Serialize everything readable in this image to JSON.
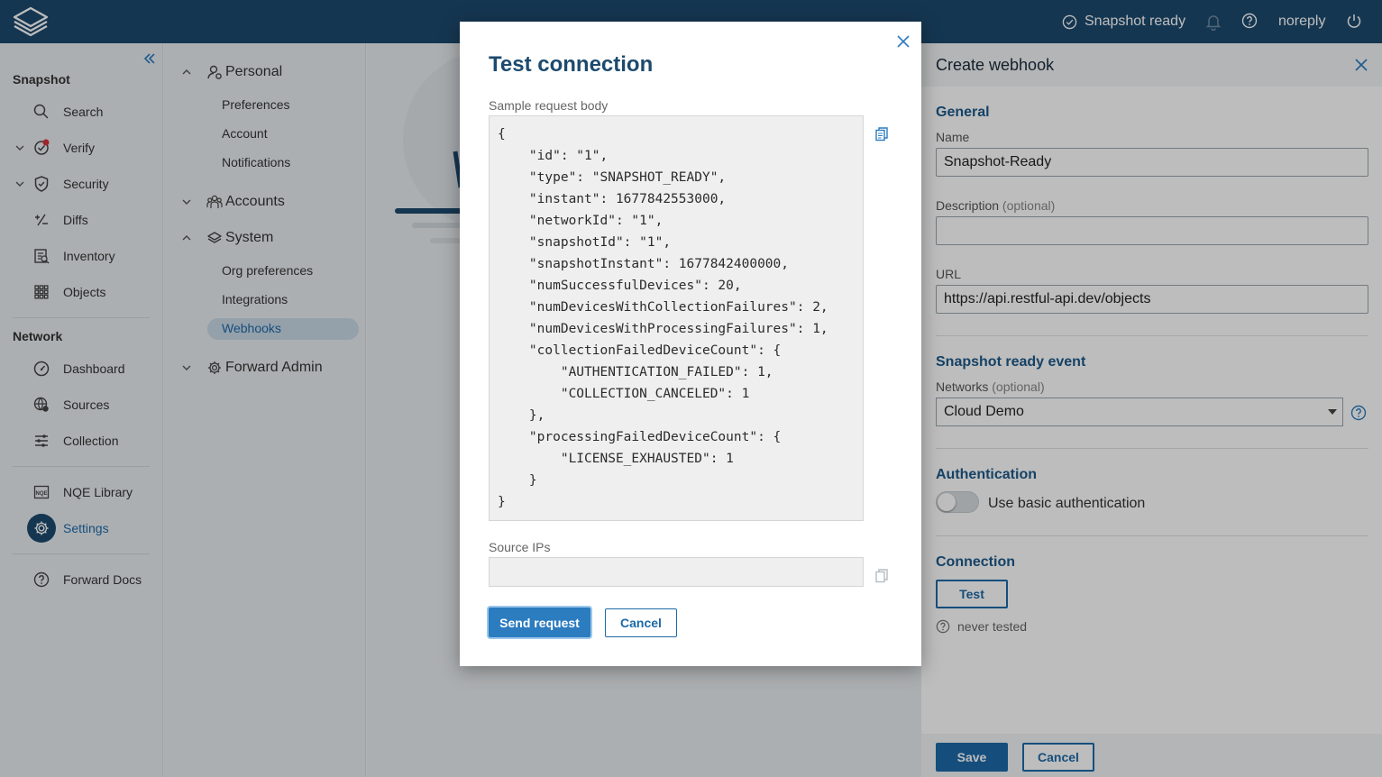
{
  "topbar": {
    "status_text": "Snapshot ready",
    "user": "noreply"
  },
  "sidebar": {
    "section_snapshot": "Snapshot",
    "section_network": "Network",
    "items": [
      {
        "label": "Search"
      },
      {
        "label": "Verify"
      },
      {
        "label": "Security"
      },
      {
        "label": "Diffs"
      },
      {
        "label": "Inventory"
      },
      {
        "label": "Objects"
      },
      {
        "label": "Dashboard"
      },
      {
        "label": "Sources"
      },
      {
        "label": "Collection"
      },
      {
        "label": "NQE Library"
      },
      {
        "label": "Settings"
      },
      {
        "label": "Forward Docs"
      }
    ]
  },
  "settings_nav": {
    "groups": [
      {
        "label": "Personal"
      },
      {
        "label": "Accounts"
      },
      {
        "label": "System"
      },
      {
        "label": "Forward Admin"
      }
    ],
    "items": [
      {
        "label": "Preferences"
      },
      {
        "label": "Account"
      },
      {
        "label": "Notifications"
      },
      {
        "label": "Org preferences"
      },
      {
        "label": "Integrations"
      },
      {
        "label": "Webhooks"
      }
    ]
  },
  "create_webhook": {
    "title": "Create webhook",
    "general_heading": "General",
    "name_label": "Name",
    "name_value": "Snapshot-Ready",
    "description_label": "Description",
    "optional": "(optional)",
    "description_value": "",
    "url_label": "URL",
    "url_value": "https://api.restful-api.dev/objects",
    "event_heading": "Snapshot ready event",
    "networks_label": "Networks",
    "networks_value": "Cloud Demo",
    "auth_heading": "Authentication",
    "auth_toggle_label": "Use basic authentication",
    "auth_enabled": false,
    "connection_heading": "Connection",
    "test_label": "Test",
    "test_status": "never tested",
    "save_label": "Save",
    "cancel_label": "Cancel"
  },
  "dialog": {
    "title": "Test connection",
    "body_label": "Sample request body",
    "body": "{\n    \"id\": \"1\",\n    \"type\": \"SNAPSHOT_READY\",\n    \"instant\": 1677842553000,\n    \"networkId\": \"1\",\n    \"snapshotId\": \"1\",\n    \"snapshotInstant\": 1677842400000,\n    \"numSuccessfulDevices\": 20,\n    \"numDevicesWithCollectionFailures\": 2,\n    \"numDevicesWithProcessingFailures\": 1,\n    \"collectionFailedDeviceCount\": {\n        \"AUTHENTICATION_FAILED\": 1,\n        \"COLLECTION_CANCELED\": 1\n    },\n    \"processingFailedDeviceCount\": {\n        \"LICENSE_EXHAUSTED\": 1\n    }\n}",
    "source_ips_label": "Source IPs",
    "source_ips_value": "",
    "send_label": "Send request",
    "cancel_label": "Cancel"
  },
  "colors": {
    "topbar": "#1d4a6e",
    "accent": "#1d6aa8",
    "heading": "#1d5a8a"
  }
}
